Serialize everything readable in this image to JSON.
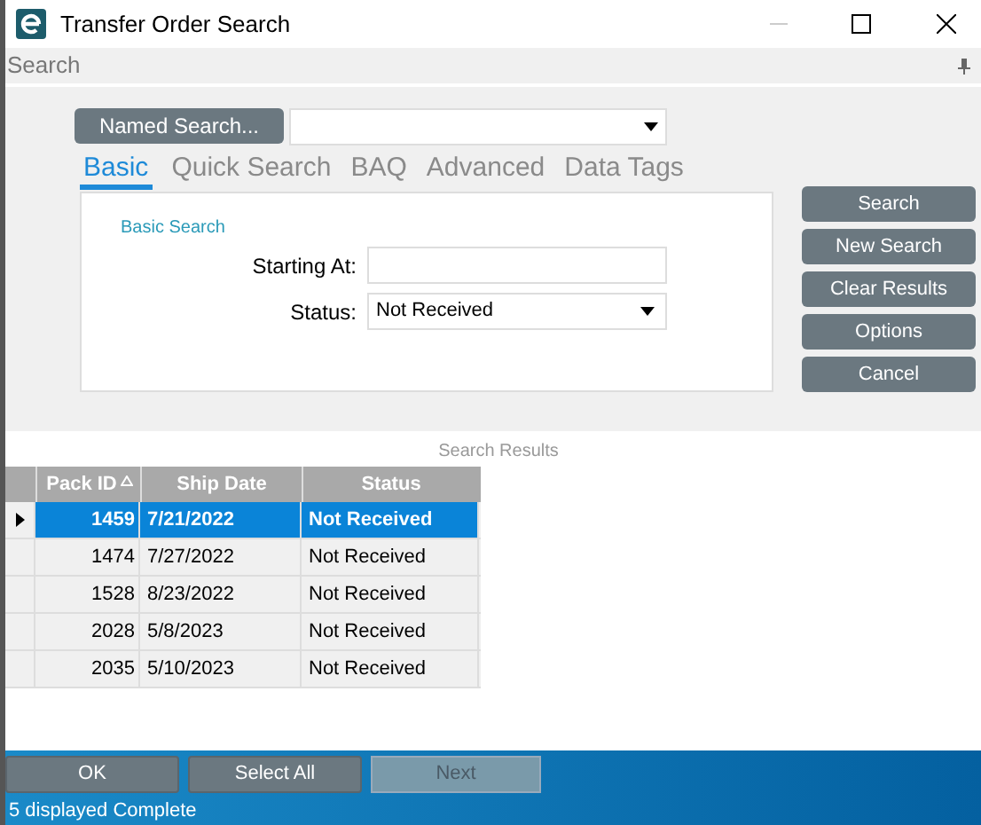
{
  "window": {
    "title": "Transfer Order Search"
  },
  "panel": {
    "title": "Search"
  },
  "named_search": {
    "button": "Named Search..."
  },
  "tabs": [
    {
      "label": "Basic",
      "selected": true
    },
    {
      "label": "Quick Search",
      "selected": false
    },
    {
      "label": "BAQ",
      "selected": false
    },
    {
      "label": "Advanced",
      "selected": false
    },
    {
      "label": "Data Tags",
      "selected": false
    }
  ],
  "basic_search": {
    "heading": "Basic Search",
    "fields": [
      {
        "kind": "text",
        "label": "Starting At:"
      },
      {
        "kind": "dropdown",
        "label": "Status:",
        "value": "Not Received"
      }
    ]
  },
  "side_buttons": [
    "Search",
    "New Search",
    "Clear Results",
    "Options",
    "Cancel"
  ],
  "results": {
    "title": "Search Results",
    "columns": [
      {
        "label": "Pack ID",
        "sorted": true
      },
      {
        "label": "Ship Date",
        "sorted": false
      },
      {
        "label": "Status",
        "sorted": false
      }
    ],
    "rows": [
      {
        "cells": [
          "1459",
          "7/21/2022",
          "Not Received"
        ],
        "selected": true
      },
      {
        "cells": [
          "1474",
          "7/27/2022",
          "Not Received"
        ],
        "selected": false
      },
      {
        "cells": [
          "1528",
          "8/23/2022",
          "Not Received"
        ],
        "selected": false
      },
      {
        "cells": [
          "2028",
          "5/8/2023",
          "Not Received"
        ],
        "selected": false
      },
      {
        "cells": [
          "2035",
          "5/10/2023",
          "Not Received"
        ],
        "selected": false
      }
    ]
  },
  "bottom_buttons": [
    {
      "label": "OK",
      "disabled": false
    },
    {
      "label": "Select All",
      "disabled": false
    },
    {
      "label": "Next",
      "disabled": true
    }
  ],
  "status_bar": "5 displayed Complete"
}
